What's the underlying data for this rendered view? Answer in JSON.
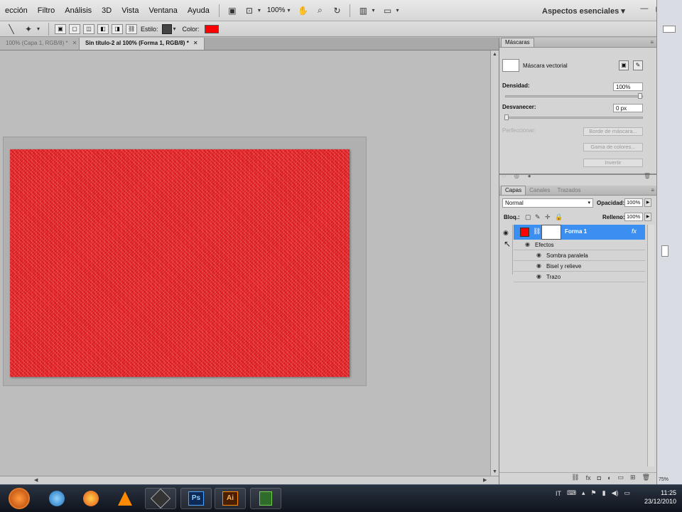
{
  "menu": {
    "items": [
      "ección",
      "Filtro",
      "Análisis",
      "3D",
      "Vista",
      "Ventana",
      "Ayuda"
    ],
    "zoom": "100%",
    "workspace": "Aspectos esenciales",
    "workspace_caret": "▾",
    "window_controls": [
      "—",
      "▢",
      "✕"
    ]
  },
  "options": {
    "style_label": "Estilo:",
    "color_label": "Color:",
    "color_value": "#ff0000"
  },
  "tabs": [
    {
      "label": "100% (Capa 1, RGB/8) *",
      "close": "✕"
    },
    {
      "label": "Sin título-2 al 100% (Forma 1, RGB/8) *",
      "close": "✕"
    }
  ],
  "canvas": {
    "fill_color": "#e8262a"
  },
  "masks_panel": {
    "title": "Máscaras",
    "mask_type": "Máscara vectorial",
    "density_label": "Densidad:",
    "density_value": "100%",
    "feather_label": "Desvanecer:",
    "feather_value": "0 px",
    "refine_label": "Perfeccionar:",
    "buttons": [
      "Borde de máscara...",
      "Gama de colores...",
      "Invertir"
    ]
  },
  "layers_panel": {
    "tabs": [
      "Capas",
      "Canales",
      "Trazados"
    ],
    "blend_mode": "Normal",
    "opacity_label": "Opacidad:",
    "opacity_value": "100%",
    "lock_label": "Bloq.:",
    "fill_label": "Relleno:",
    "fill_value": "100%",
    "layer": {
      "name": "Forma 1",
      "fx": "fx",
      "thumb_color": "#ff0000",
      "selected_color": "#3b8ff0"
    },
    "effects_label": "Efectos",
    "effects": [
      "Sombra paralela",
      "Bisel y relieve",
      "Trazo"
    ]
  },
  "sliver": {
    "percent": "75%"
  },
  "taskbar": {
    "apps": [
      "ps",
      "ai"
    ],
    "ps_label": "Ps",
    "ai_label": "Ai",
    "lang": "IT",
    "time": "11:25",
    "date": "23/12/2010"
  }
}
